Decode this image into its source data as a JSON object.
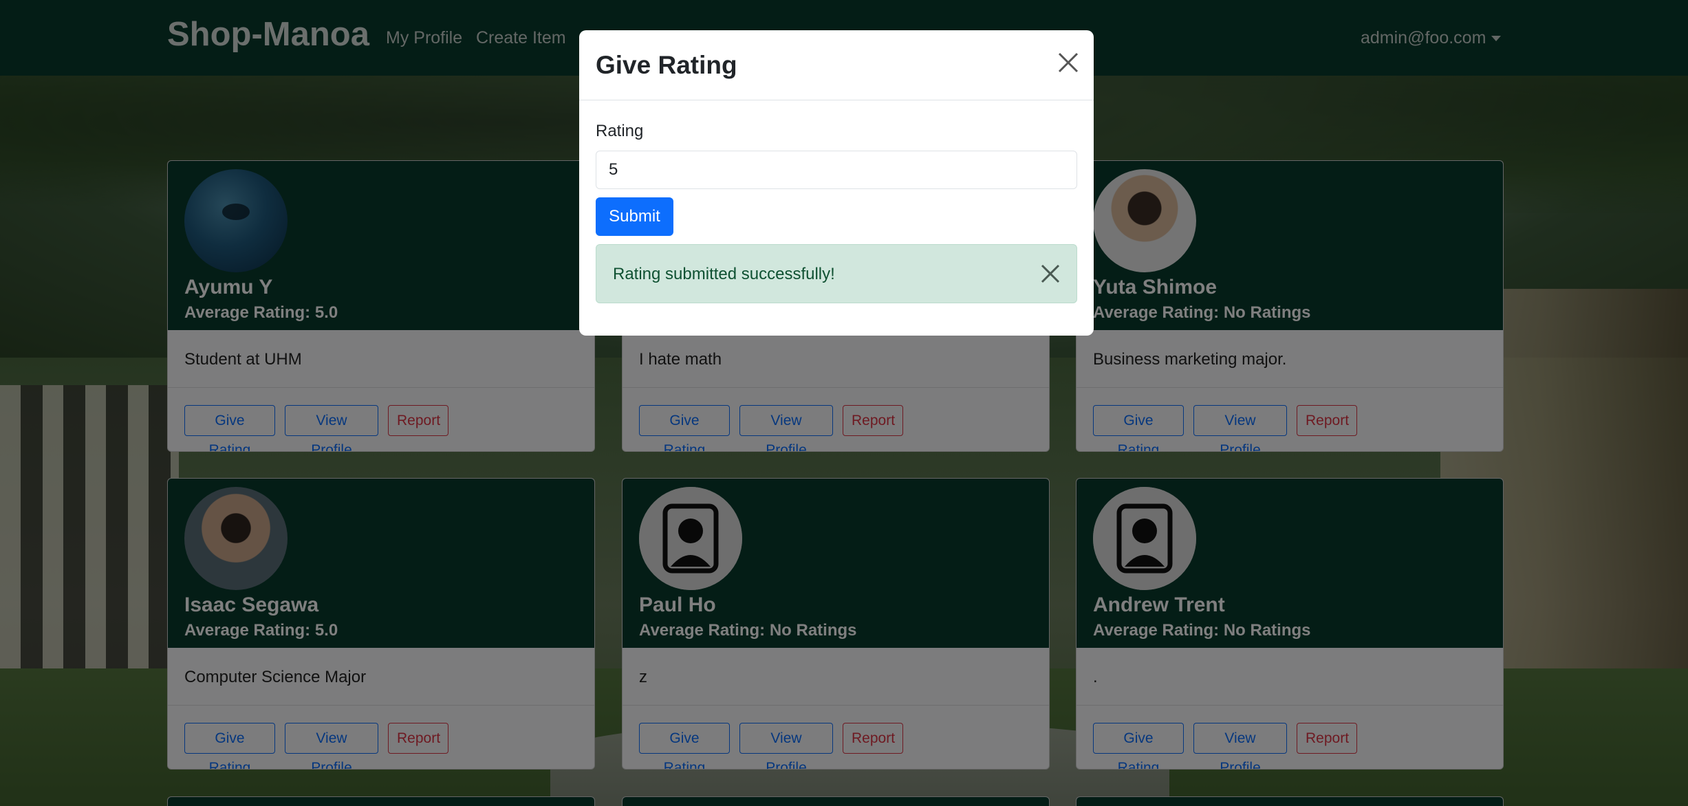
{
  "navbar": {
    "brand": "Shop-Manoa",
    "links": [
      "My Profile",
      "Create Item"
    ],
    "user": "admin@foo.com"
  },
  "cards": [
    {
      "name": "Ayumu Y",
      "average_label": "Average Rating: 5.0",
      "bio": "Student at UHM",
      "avatar_icon": "ocean-photo-avatar"
    },
    {
      "name": "",
      "average_label": "",
      "bio": "I hate math",
      "avatar_icon": "avatar"
    },
    {
      "name": "Yuta Shimoe",
      "average_label": "Average Rating: No Ratings",
      "bio": "Business marketing major.",
      "avatar_icon": "portrait-photo-avatar"
    },
    {
      "name": "Isaac Segawa",
      "average_label": "Average Rating: 5.0",
      "bio": "Computer Science Major",
      "avatar_icon": "portrait-photo-avatar"
    },
    {
      "name": "Paul Ho",
      "average_label": "Average Rating: No Ratings",
      "bio": "z",
      "avatar_icon": "default-person-icon"
    },
    {
      "name": "Andrew Trent",
      "average_label": "Average Rating: No Ratings",
      "bio": ".",
      "avatar_icon": "default-person-icon"
    }
  ],
  "card_buttons": {
    "give_rating": "Give Rating",
    "view_profile": "View Profile",
    "report": "Report"
  },
  "modal": {
    "title": "Give Rating",
    "field_label": "Rating",
    "field_value": "5",
    "submit_label": "Submit",
    "alert_message": "Rating submitted successfully!"
  },
  "colors": {
    "navbar": "#083b2c",
    "primary": "#0d6efd",
    "danger": "#dc3545",
    "success_bg": "#d1e7dd"
  }
}
